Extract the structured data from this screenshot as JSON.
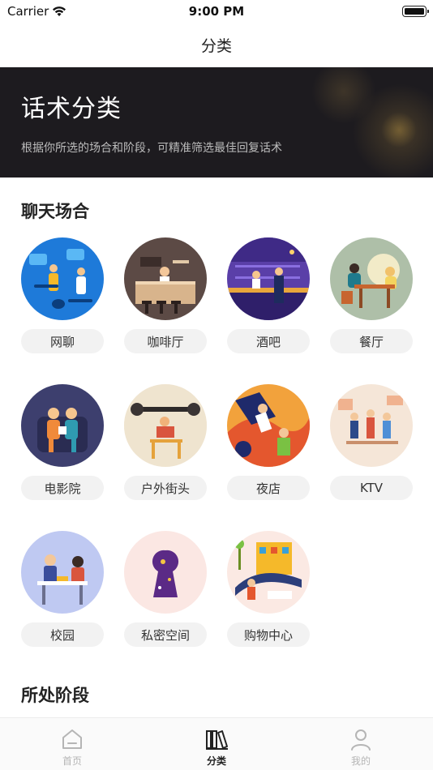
{
  "status_bar": {
    "carrier": "Carrier",
    "time": "9:00 PM"
  },
  "nav": {
    "title": "分类"
  },
  "banner": {
    "title": "话术分类",
    "subtitle": "根据你所选的场合和阶段，可精准筛选最佳回复话术"
  },
  "sections": {
    "chat_scenes_title": "聊天场合",
    "stage_title": "所处阶段"
  },
  "scenes": [
    {
      "label": "网聊",
      "icon": "online-chat-illustration"
    },
    {
      "label": "咖啡厅",
      "icon": "coffee-shop-illustration"
    },
    {
      "label": "酒吧",
      "icon": "bar-illustration"
    },
    {
      "label": "餐厅",
      "icon": "restaurant-illustration"
    },
    {
      "label": "电影院",
      "icon": "cinema-illustration"
    },
    {
      "label": "户外街头",
      "icon": "street-illustration"
    },
    {
      "label": "夜店",
      "icon": "nightclub-illustration"
    },
    {
      "label": "KTV",
      "icon": "ktv-illustration"
    },
    {
      "label": "校园",
      "icon": "campus-illustration"
    },
    {
      "label": "私密空间",
      "icon": "private-space-illustration"
    },
    {
      "label": "购物中心",
      "icon": "shopping-mall-illustration"
    }
  ],
  "tabs": [
    {
      "label": "首页",
      "icon": "home-icon",
      "active": false
    },
    {
      "label": "分类",
      "icon": "books-icon",
      "active": true
    },
    {
      "label": "我的",
      "icon": "person-icon",
      "active": false
    }
  ],
  "colors": {
    "banner_bg": "#1d1b1f",
    "pill_bg": "#f2f2f2",
    "tab_active": "#222222",
    "tab_inactive": "#b5b5b5"
  }
}
